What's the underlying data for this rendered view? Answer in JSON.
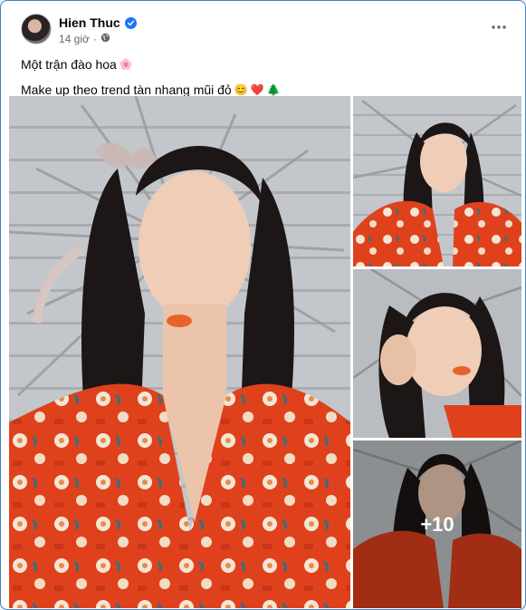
{
  "post": {
    "author": "Hien Thuc",
    "time": "14 giờ",
    "separator": "·",
    "audience_icon": "public-globe-icon",
    "line1": "Một trận đào hoa",
    "line1_emoji": "🌸",
    "line2": "Make up theo trend tàn nhang mũi đỏ",
    "line2_emojis": [
      "😊",
      "❤️",
      "🌲"
    ]
  },
  "photos": {
    "more_count": "+10",
    "colors": {
      "wall": "#bfc3c7",
      "robe": "#e0411d",
      "hair": "#1c1616",
      "skin": "#f0cdb6",
      "foliage": "#8d9198"
    }
  },
  "colors": {
    "accent": "#1877f2",
    "secondary_text": "#65676b",
    "border": "#3b82c4"
  }
}
